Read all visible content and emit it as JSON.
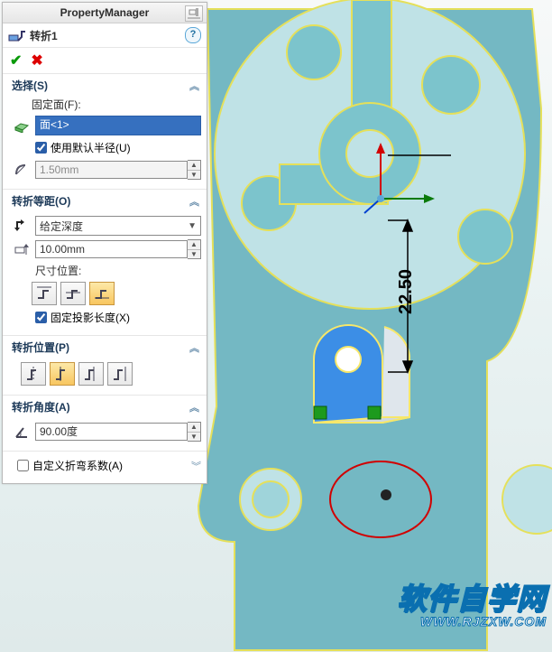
{
  "panel": {
    "title": "PropertyManager"
  },
  "feature": {
    "name": "转折1"
  },
  "sections": {
    "select": {
      "title": "选择(S)",
      "fixedFaceLabel": "固定面(F):",
      "selectedFace": "面<1>",
      "useDefRadius_checked": true,
      "useDefRadius_label": "使用默认半径(U)",
      "radiusValue": "1.50mm"
    },
    "offset": {
      "title": "转折等距(O)",
      "depthType": "给定深度",
      "depthValue": "10.00mm",
      "dimPosLabel": "尺寸位置:",
      "fixProj_checked": true,
      "fixProj_label": "固定投影长度(X)"
    },
    "jogpos": {
      "title": "转折位置(P)"
    },
    "angle": {
      "title": "转折角度(A)",
      "angleValue": "90.00度"
    },
    "custom": {
      "checked": false,
      "label": "自定义折弯系数(A)"
    }
  },
  "viewport": {
    "dimValue": "22.50"
  },
  "watermark": {
    "cn": "软件自学网",
    "url": "WWW.RJZXW.COM"
  }
}
